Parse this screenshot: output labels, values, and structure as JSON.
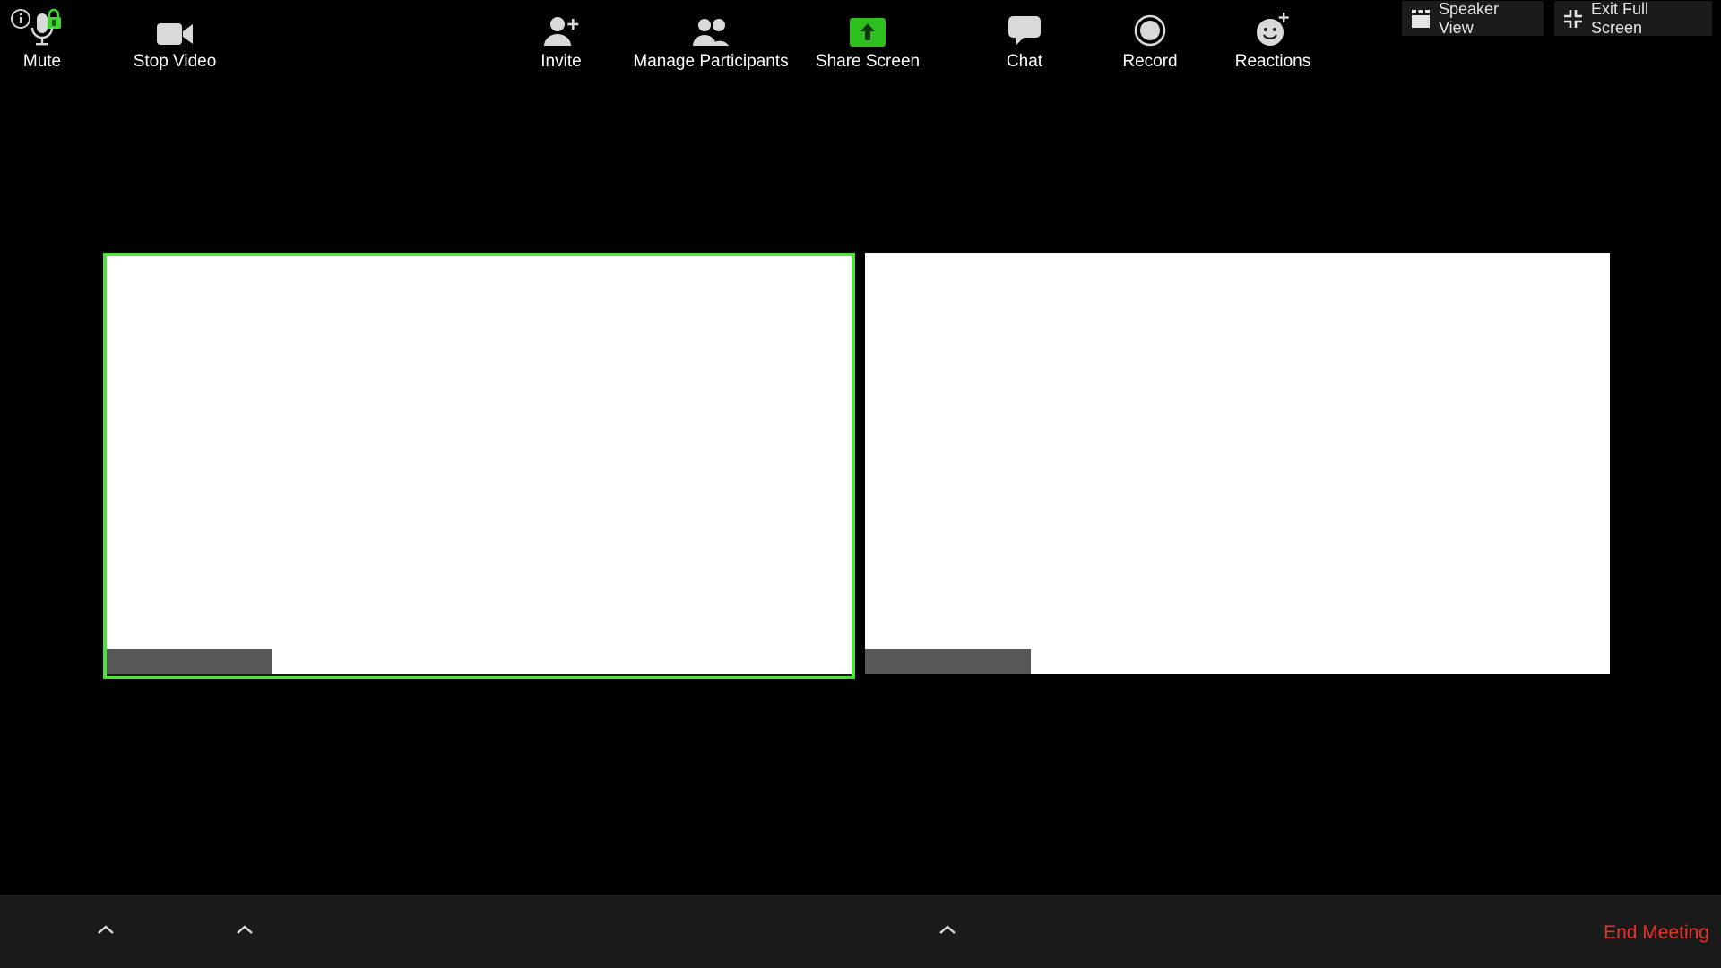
{
  "top_left": {
    "info_icon": "info-icon",
    "lock_icon": "lock-icon",
    "lock_color": "#3dd62f"
  },
  "top_right": {
    "speaker_view_label": "Speaker View",
    "speaker_view_icon": "gallery-grid-icon",
    "exit_full_screen_label": "Exit Full Screen",
    "exit_full_screen_icon": "compress-icon"
  },
  "tiles": [
    {
      "name": "",
      "active_speaker": true,
      "highlight_color": "#4fe13a"
    },
    {
      "name": "",
      "active_speaker": false
    }
  ],
  "toolbar": {
    "mute_label": "Mute",
    "stop_video_label": "Stop Video",
    "invite_label": "Invite",
    "manage_participants_label": "Manage Participants",
    "share_screen_label": "Share Screen",
    "share_screen_color": "#2fbf1e",
    "chat_label": "Chat",
    "record_label": "Record",
    "reactions_label": "Reactions",
    "end_meeting_label": "End Meeting",
    "end_meeting_color": "#e8332b"
  }
}
